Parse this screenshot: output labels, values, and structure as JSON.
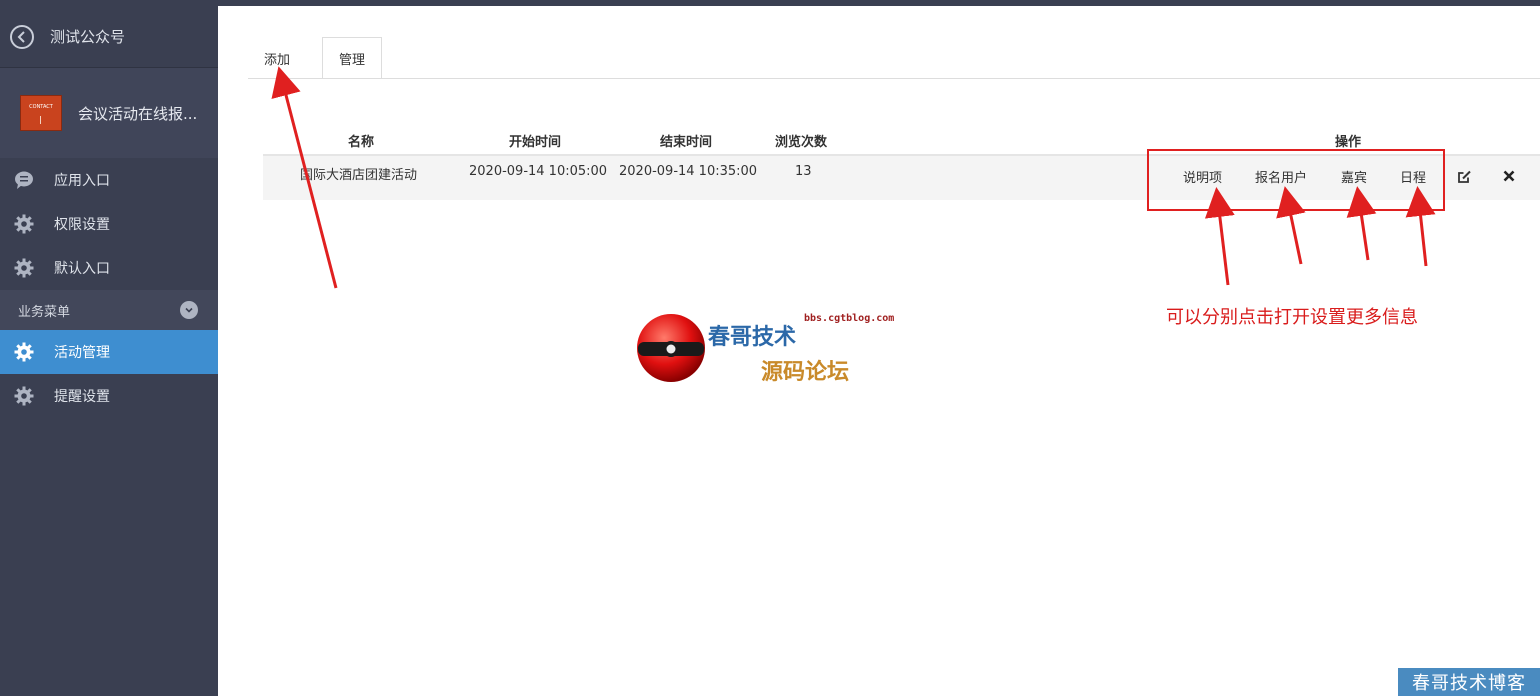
{
  "sidebar": {
    "account_name": "测试公众号",
    "app_name": "会议活动在线报...",
    "app_logo_text": "CONTACT",
    "items": [
      {
        "label": "应用入口",
        "icon": "chat-icon"
      },
      {
        "label": "权限设置",
        "icon": "gear-icon"
      },
      {
        "label": "默认入口",
        "icon": "gear-icon"
      }
    ],
    "section": {
      "label": "业务菜单"
    },
    "sub_items": [
      {
        "label": "活动管理",
        "icon": "gear-icon",
        "active": true
      },
      {
        "label": "提醒设置",
        "icon": "gear-icon"
      }
    ]
  },
  "tabs": [
    {
      "label": "添加"
    },
    {
      "label": "管理",
      "active": true
    }
  ],
  "table": {
    "headers": {
      "name": "名称",
      "start": "开始时间",
      "end": "结束时间",
      "views": "浏览次数",
      "ops": "操作"
    },
    "rows": [
      {
        "name": "国际大酒店团建活动",
        "start": "2020-09-14 10:05:00",
        "end": "2020-09-14 10:35:00",
        "views": "13"
      }
    ],
    "row_actions": [
      "说明项",
      "报名用户",
      "嘉宾",
      "日程"
    ]
  },
  "annotation": {
    "text": "可以分别点击打开设置更多信息",
    "color": "#d91c1c"
  },
  "watermark": {
    "site": "bbs.cgtblog.com",
    "line1": "春哥技术",
    "line2": "源码论坛",
    "corner": "春哥技术博客"
  },
  "colors": {
    "sidebar_bg": "#3a3f51",
    "active_bg": "#3e8ed0",
    "annotation_red": "#e02020"
  }
}
